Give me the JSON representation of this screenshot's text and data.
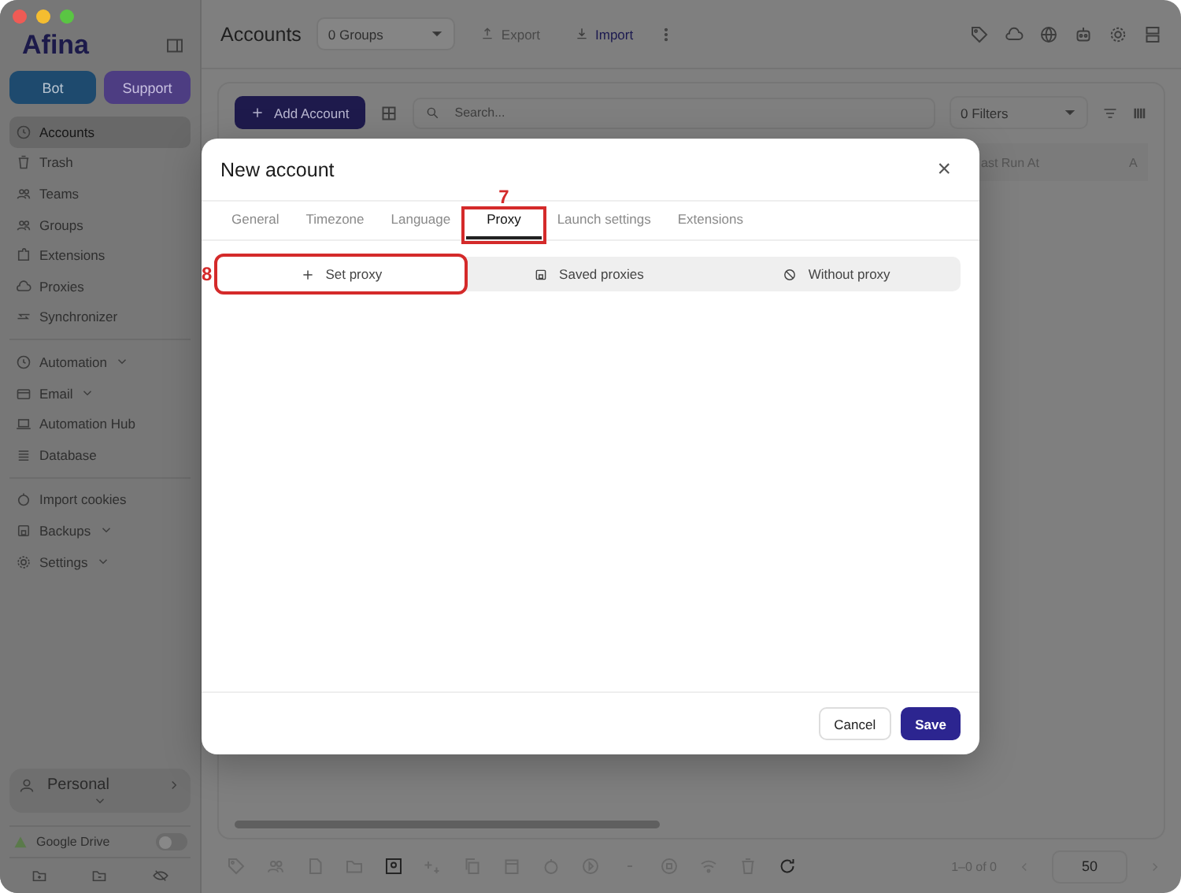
{
  "sidebar": {
    "logo": "Afina",
    "buttons": [
      {
        "label": "Bot",
        "kind": "bot"
      },
      {
        "label": "Support",
        "kind": "support"
      }
    ],
    "groups": [
      [
        {
          "label": "Accounts",
          "selected": true,
          "dropdown": false
        },
        {
          "label": "Trash",
          "selected": false,
          "dropdown": false
        },
        {
          "label": "Teams",
          "selected": false,
          "dropdown": false
        },
        {
          "label": "Groups",
          "selected": false,
          "dropdown": false
        },
        {
          "label": "Extensions",
          "selected": false,
          "dropdown": false
        },
        {
          "label": "Proxies",
          "selected": false,
          "dropdown": false
        },
        {
          "label": "Synchronizer",
          "selected": false,
          "dropdown": false
        }
      ],
      [
        {
          "label": "Automation",
          "selected": false,
          "dropdown": true
        },
        {
          "label": "Email",
          "selected": false,
          "dropdown": true
        },
        {
          "label": "Automation Hub",
          "selected": false,
          "dropdown": false
        },
        {
          "label": "Database",
          "selected": false,
          "dropdown": false
        }
      ],
      [
        {
          "label": "Import cookies",
          "selected": false,
          "dropdown": false
        },
        {
          "label": "Backups",
          "selected": false,
          "dropdown": true
        },
        {
          "label": "Settings",
          "selected": false,
          "dropdown": true
        }
      ]
    ],
    "workspace": "Personal",
    "drive": {
      "label": "Google Drive",
      "on": false
    }
  },
  "header": {
    "title": "Accounts",
    "groups_select": "0 Groups",
    "actions": [
      {
        "label": "Export",
        "disabled": true
      },
      {
        "label": "Import",
        "disabled": false
      }
    ]
  },
  "toolbar": {
    "add_button": "Add Account",
    "search": {
      "placeholder": "Search..."
    },
    "filters_select": "0 Filters"
  },
  "table": {
    "columns": [
      "ast Run At",
      "A"
    ]
  },
  "pagination": {
    "range": "1–0 of 0",
    "page_size": "50"
  },
  "modal": {
    "title": "New account",
    "close": "×",
    "tabs": [
      {
        "label": "General",
        "selected": false
      },
      {
        "label": "Timezone",
        "selected": false
      },
      {
        "label": "Language",
        "selected": false
      },
      {
        "label": "Proxy",
        "selected": true,
        "callout": "7"
      },
      {
        "label": "Launch settings",
        "selected": false
      },
      {
        "label": "Extensions",
        "selected": false
      }
    ],
    "proxy_modes": [
      {
        "label": "Set proxy",
        "selected": true,
        "callout": "8"
      },
      {
        "label": "Saved proxies",
        "selected": false
      },
      {
        "label": "Without proxy",
        "selected": false
      }
    ],
    "buttons": [
      {
        "label": "Cancel",
        "kind": "secondary"
      },
      {
        "label": "Save",
        "kind": "primary"
      }
    ]
  }
}
